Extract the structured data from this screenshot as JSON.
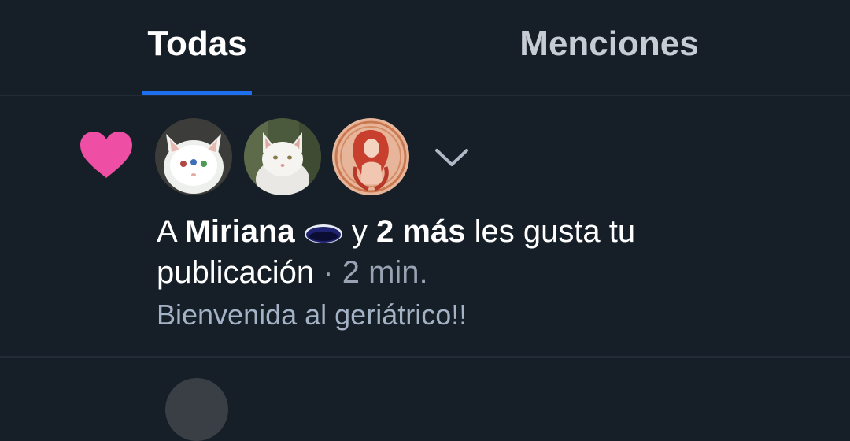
{
  "tabs": {
    "all_label": "Todas",
    "mentions_label": "Menciones",
    "active": "Todas"
  },
  "notification": {
    "icon": "heart-icon",
    "icon_color": "#ee4fa4",
    "prefix": "A",
    "user_name": "Miriana",
    "user_emoji": "moon-icon",
    "connector": "y",
    "others": "2 más",
    "action": "les gusta tu publicación",
    "separator": "·",
    "time": "2 min.",
    "preview": "Bienvenida al geriátrico!!",
    "avatars": [
      "white-cat-avatar",
      "white-cat-avatar-2",
      "art-nouveau-avatar"
    ]
  },
  "colors": {
    "background": "#161e27",
    "accent": "#1d6ff0",
    "heart": "#ee4fa4",
    "muted_text": "#a3b2c4"
  }
}
